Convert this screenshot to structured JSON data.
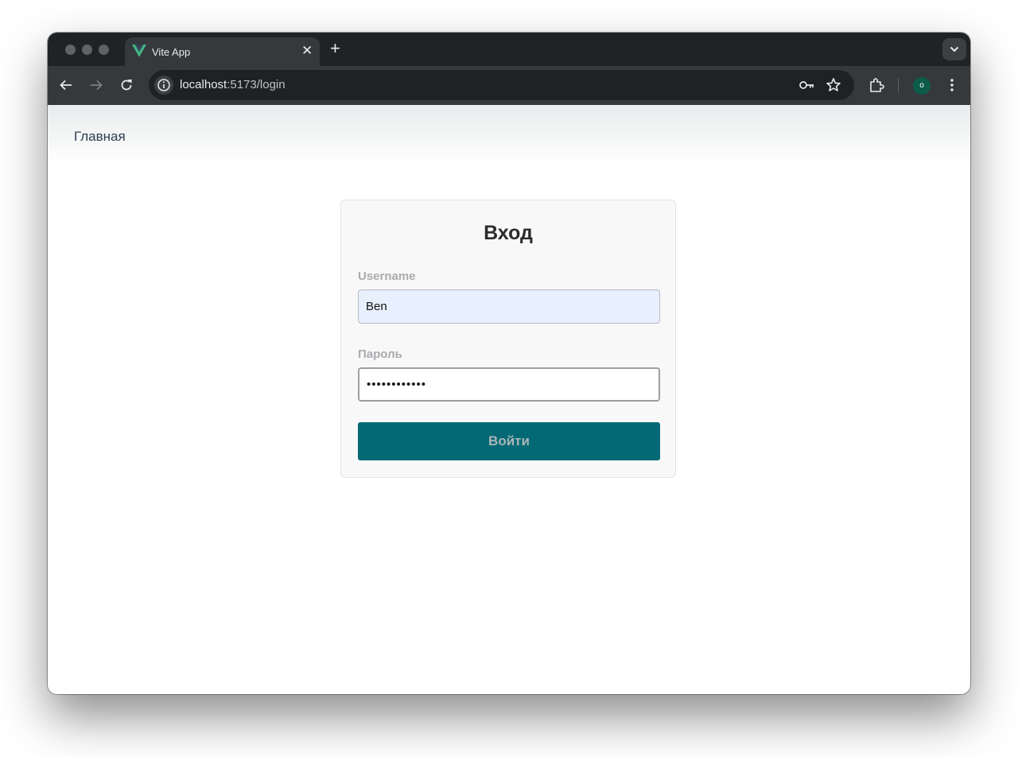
{
  "browser": {
    "tab": {
      "title": "Vite App",
      "close_glyph": "✕"
    },
    "new_tab_glyph": "+",
    "tab_menu_glyph": "⌄",
    "url_host": "localhost",
    "url_path": ":5173/login",
    "profile_initial": "o",
    "icons": [
      "back-icon",
      "forward-icon",
      "reload-icon",
      "site-info-icon",
      "password-key-icon",
      "bookmark-star-icon",
      "extensions-icon",
      "more-menu-icon",
      "vue-logo-icon"
    ]
  },
  "nav": {
    "home_link": "Главная"
  },
  "login": {
    "title": "Вход",
    "username_label": "Username",
    "username_value": "Ben",
    "password_label": "Пароль",
    "password_value": "jdkfjkdfjkdj",
    "submit_label": "Войти"
  },
  "colors": {
    "accent_button": "#036a75",
    "vue_green": "#42b883",
    "autofill_bg": "#e8f0fe",
    "avatar": "#0d5c4a"
  }
}
